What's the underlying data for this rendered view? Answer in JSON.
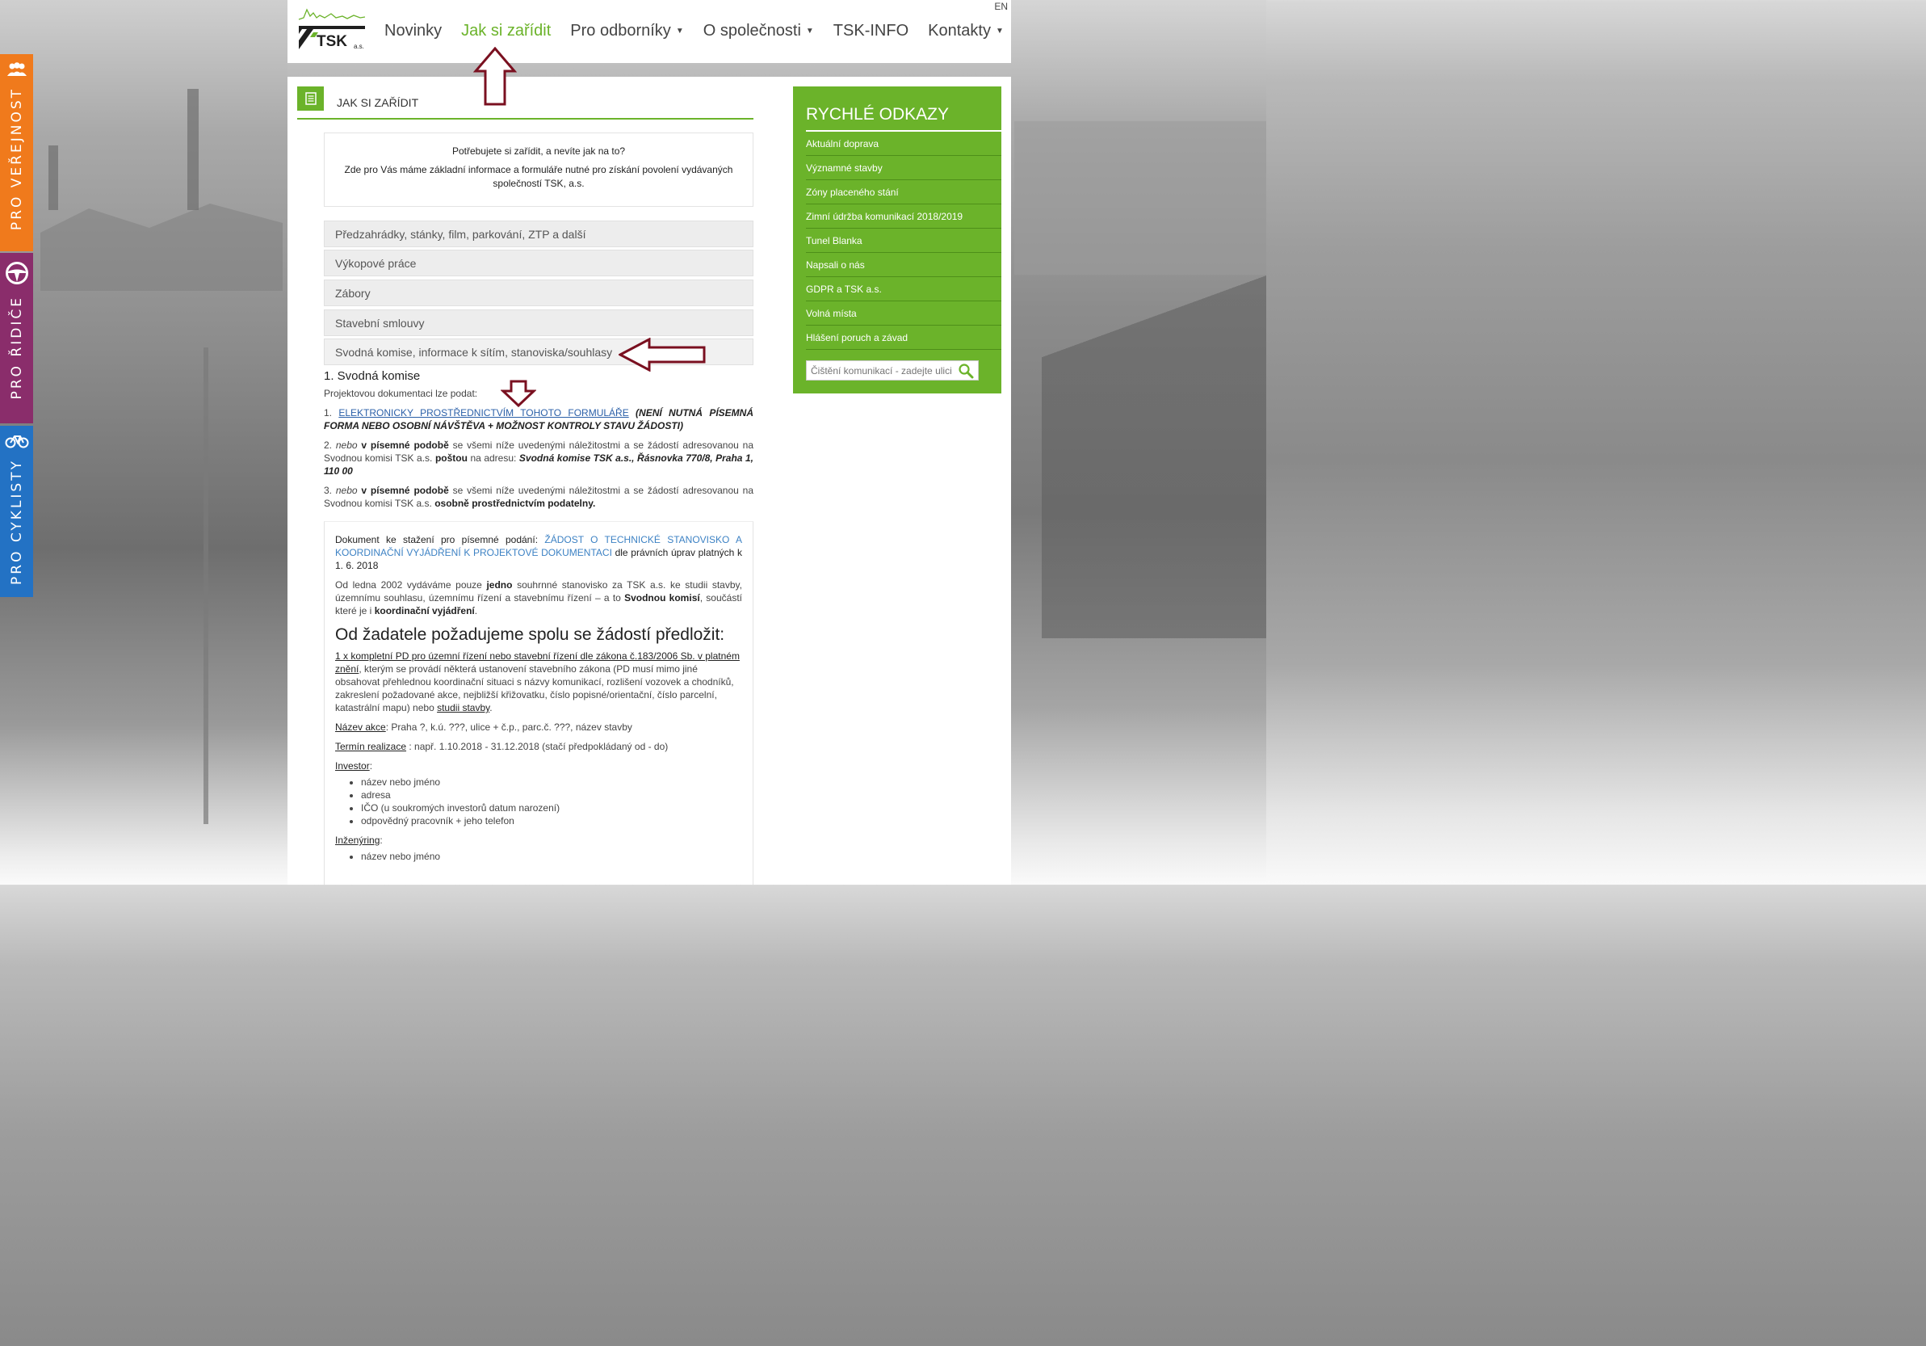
{
  "side_tabs": [
    {
      "label": "PRO VEŘEJNOST",
      "icon": "people-icon"
    },
    {
      "label": "PRO ŘIDIČE",
      "icon": "steering-wheel-icon"
    },
    {
      "label": "PRO CYKLISTY",
      "icon": "bicycle-icon"
    }
  ],
  "header": {
    "logo_text": "TSK",
    "logo_suffix": "a.s.",
    "lang": "EN",
    "nav": [
      {
        "label": "Novinky",
        "active": false,
        "dropdown": false
      },
      {
        "label": "Jak si zařídit",
        "active": true,
        "dropdown": false
      },
      {
        "label": "Pro odborníky",
        "active": false,
        "dropdown": true
      },
      {
        "label": "O společnosti",
        "active": false,
        "dropdown": true
      },
      {
        "label": "TSK-INFO",
        "active": false,
        "dropdown": false
      },
      {
        "label": "Kontakty",
        "active": false,
        "dropdown": true
      }
    ]
  },
  "page": {
    "title": "JAK SI ZAŘÍDIT",
    "intro_question": "Potřebujete si zařídit, a nevíte jak na to?",
    "intro_text": "Zde pro Vás máme základní informace a formuláře nutné pro získání povolení vydávaných společností TSK, a.s.",
    "accordion": [
      "Předzahrádky, stánky, film, parkování, ZTP a další",
      "Výkopové práce",
      "Zábory",
      "Stavební smlouvy",
      "Svodná komise, informace k sítím, stanoviska/souhlasy"
    ],
    "section": {
      "heading": "1. Svodná komise",
      "lead": "Projektovou  dokumentaci lze podat:",
      "item1_num": "1.",
      "item1_link": "ELEKTRONICKY PROSTŘEDNICTVÍM TOHOTO FORMULÁŘE",
      "item1_note": "(NENÍ NUTNÁ PÍSEMNÁ FORMA NEBO OSOBNÍ NÁVŠTĚVA + MOŽNOST KONTROLY STAVU ŽÁDOSTI)",
      "item2_num": "2.",
      "item2_or": "nebo",
      "item2_form": "v písemné podobě",
      "item2_mid": "se všemi níže uvedenými náležitostmi a se žádostí adresovanou na Svodnou komisi TSK a.s.",
      "item2_post": "poštou",
      "item2_addr_pre": "na adresu:",
      "item2_addr": "Svodná komise TSK a.s., Řásnovka 770/8, Praha 1, 110 00",
      "item3_num": "3.",
      "item3_or": "nebo",
      "item3_form": "v písemné podobě",
      "item3_mid": "se všemi níže uvedenými náležitostmi a se žádostí adresovanou na Svodnou komisi TSK a.s.",
      "item3_end": "osobně prostřednictvím podatelny."
    },
    "doc": {
      "dl_pre": "Dokument ke stažení pro písemné podání:",
      "dl_link": "ŽÁDOST O TECHNICKÉ STANOVISKO A KOORDINAČNÍ VYJÁDŘENÍ K PROJEKTOVÉ DOKUMENTACI",
      "dl_post": "dle právních úprav platných k 1. 6. 2018",
      "p2_a": "Od ledna 2002 vydáváme pouze",
      "p2_b": "jedno",
      "p2_c": "souhrnné stanovisko za TSK a.s. ke studii stavby, územnímu souhlasu, územnímu řízení a stavebnímu řízení –    a to",
      "p2_d": "Svodnou komisí",
      "p2_e": ", součástí které je i",
      "p2_f": "koordinační vyjádření",
      "p2_g": ".",
      "heading": "Od žadatele požadujeme spolu se žádostí předložit:",
      "req1_u": "1 x kompletní PD pro územní řízení nebo stavební řízení dle zákona č.183/2006 Sb. v platném znění",
      "req1_t": ", kterým se provádí některá ustanovení stavebního zákona (PD musí mimo jiné obsahovat přehlednou koordinační situaci s názvy komunikací, rozlišení vozovek a chodníků, zakreslení požadované akce, nejbližší křižovatku, číslo popisné/orientační, číslo parcelní, katastrální mapu) nebo",
      "req1_s": "studii stavby",
      "req1_end": ".",
      "name_label": "Název akce",
      "name_val": ": Praha ?, k.ú. ???, ulice + č.p., parc.č. ???, název stavby",
      "term_label": "Termín realizace",
      "term_val": " : např. 1.10.2018 - 31.12.2018 (stačí předpokládaný od - do)",
      "investor_label": "Investor",
      "investor_items": [
        "název nebo jméno",
        "adresa",
        "IČO (u soukromých investorů datum narození)",
        "odpovědný pracovník + jeho telefon"
      ],
      "eng_label": "Inženýring",
      "eng_items": [
        "název nebo jméno"
      ]
    }
  },
  "sidebar": {
    "title": "RYCHLÉ ODKAZY",
    "links": [
      "Aktuální doprava",
      "Významné stavby",
      "Zóny placeného stání",
      "Zimní údržba komunikací 2018/2019",
      "Tunel Blanka",
      "Napsali o nás",
      "GDPR a TSK a.s.",
      "Volná místa",
      "Hlášení poruch a závad"
    ],
    "search_placeholder": "Čištění komunikací - zadejte ulici"
  },
  "colors": {
    "brand_green": "#6bb32a",
    "orange": "#f07a1c",
    "purple": "#8a2d6b",
    "blue": "#2372c4",
    "annotation": "#7a1020"
  }
}
